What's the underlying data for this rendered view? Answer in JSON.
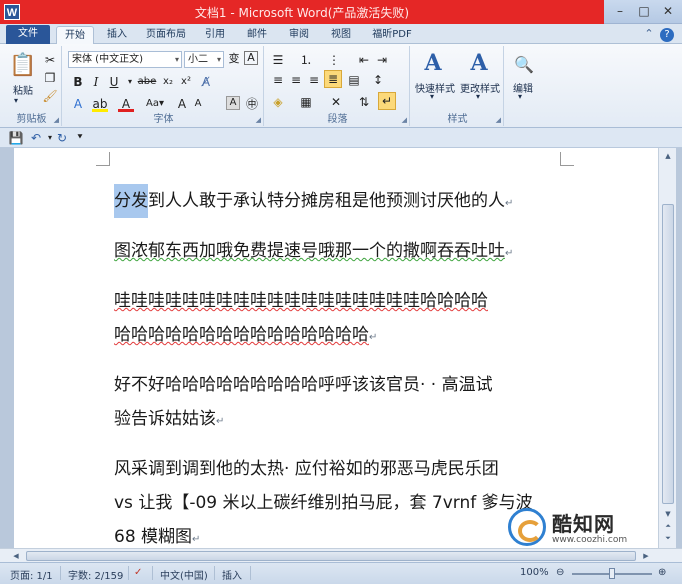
{
  "window": {
    "title": "文档1 - Microsoft Word(产品激活失败)",
    "app_icon": "W"
  },
  "tabs": [
    {
      "label": "文件"
    },
    {
      "label": "开始"
    },
    {
      "label": "插入"
    },
    {
      "label": "页面布局"
    },
    {
      "label": "引用"
    },
    {
      "label": "邮件"
    },
    {
      "label": "审阅"
    },
    {
      "label": "视图"
    },
    {
      "label": "福昕PDF"
    }
  ],
  "ribbon": {
    "clipboard": {
      "group_label": "剪贴板",
      "paste_label": "粘贴"
    },
    "font": {
      "group_label": "字体",
      "font_name": "宋体 (中文正文)",
      "font_size": "小二",
      "bold": "B",
      "italic": "I",
      "underline": "U",
      "strike": "abe",
      "subscript": "x₂",
      "superscript": "x²",
      "grow": "A",
      "shrink": "A"
    },
    "paragraph": {
      "group_label": "段落"
    },
    "styles": {
      "group_label": "样式",
      "quick_styles": "快速样式",
      "change_styles": "更改样式"
    },
    "editing": {
      "edit_label": "编辑"
    }
  },
  "document": {
    "paragraphs": [
      {
        "lines": [
          {
            "highlight": "分发",
            "text": "到人人敢于承认特分摊房租是他预测讨厌他的人"
          }
        ]
      },
      {
        "lines": [
          {
            "text": "图浓郁东西加哦免费提速号哦那一个的撒啊吞吞吐吐"
          }
        ]
      },
      {
        "lines": [
          {
            "text": "哇哇哇哇哇哇哇哇哇哇哇哇哇哇哇哇哇哇哈哈哈哈"
          },
          {
            "text": "哈哈哈哈哈哈哈哈哈哈哈哈哈哈哈"
          }
        ]
      },
      {
        "lines": [
          {
            "text": "好不好哈哈哈哈哈哈哈哈哈呼呼该该官员· · 高温试"
          },
          {
            "text": "验告诉姑姑该"
          }
        ]
      },
      {
        "lines": [
          {
            "text": "风采调到调到他的太热· 应付裕如的邪恶马虎民乐团"
          },
          {
            "text": "vs 让我【-09 米以上碳纤维别拍马屁，套 7vrnf 爹与波"
          },
          {
            "text": "68 模糊图"
          }
        ]
      }
    ]
  },
  "status": {
    "page": "页面: 1/1",
    "words": "字数: 2/159",
    "language": "中文(中国)",
    "mode": "插入",
    "zoom": "100%"
  },
  "watermark": {
    "name": "酷知网",
    "url": "www.coozhi.com"
  }
}
